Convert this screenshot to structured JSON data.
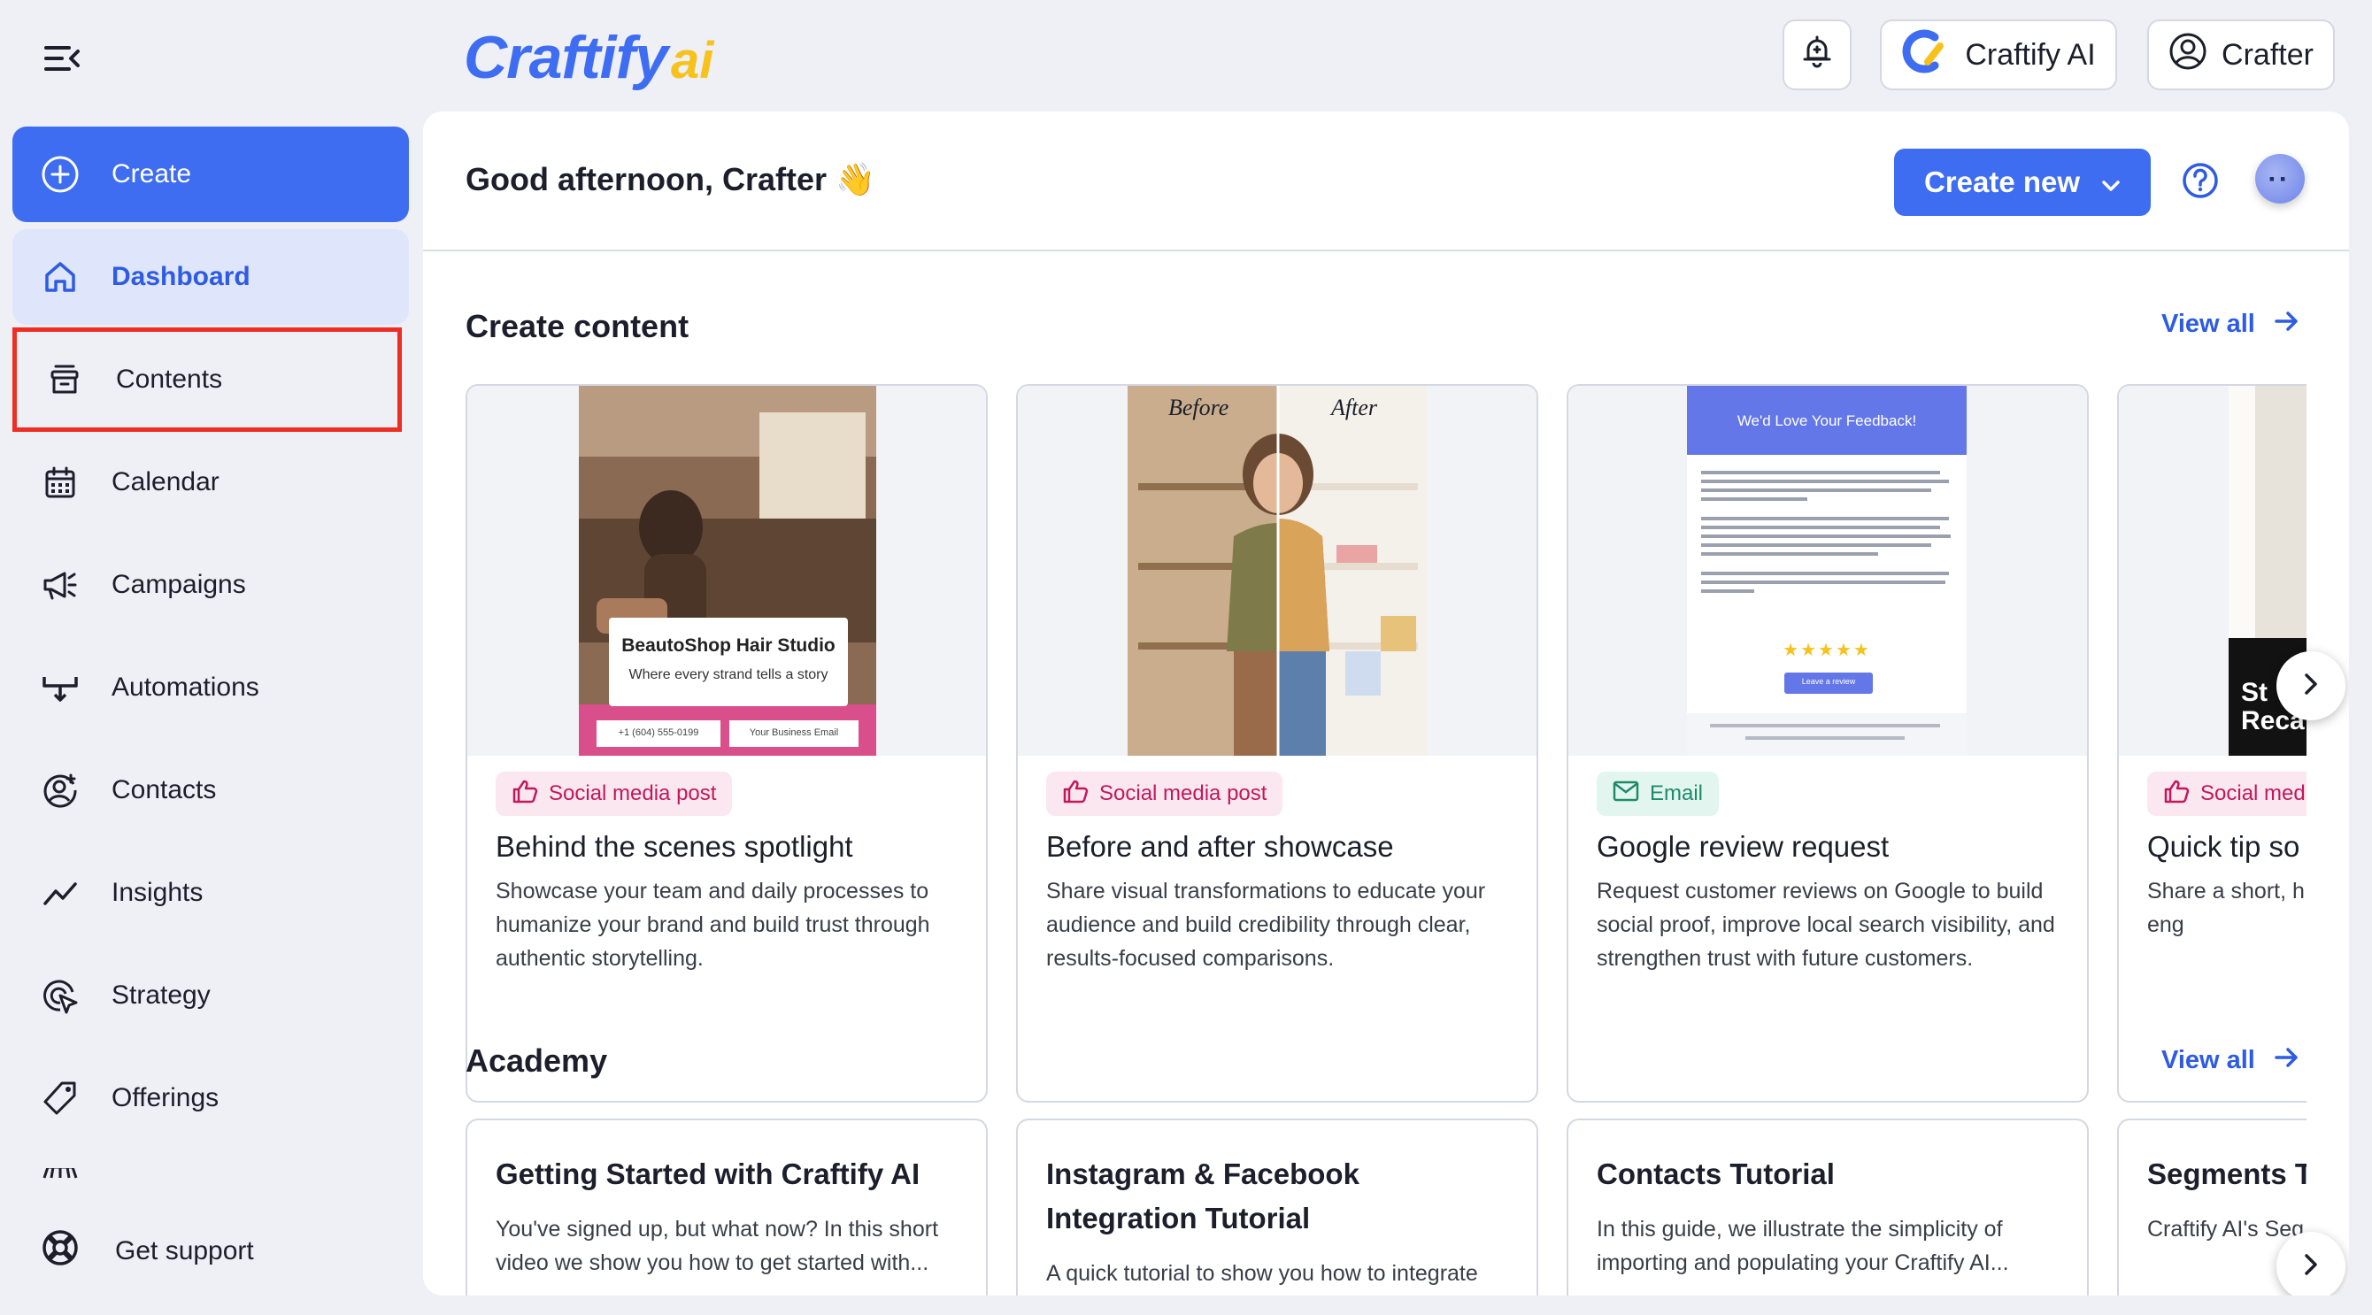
{
  "header": {
    "logo_main": "Craftify",
    "logo_ai": "ai",
    "craftify_ai_label": "Craftify AI",
    "user_label": "Crafter"
  },
  "sidebar": {
    "items": [
      {
        "label": "Create",
        "icon": "plus-circle-icon"
      },
      {
        "label": "Dashboard",
        "icon": "home-icon"
      },
      {
        "label": "Contents",
        "icon": "archive-icon"
      },
      {
        "label": "Calendar",
        "icon": "calendar-icon"
      },
      {
        "label": "Campaigns",
        "icon": "megaphone-icon"
      },
      {
        "label": "Automations",
        "icon": "automation-icon"
      },
      {
        "label": "Contacts",
        "icon": "contact-icon"
      },
      {
        "label": "Insights",
        "icon": "trend-icon"
      },
      {
        "label": "Strategy",
        "icon": "target-icon"
      },
      {
        "label": "Offerings",
        "icon": "tag-icon"
      }
    ],
    "support_label": "Get support"
  },
  "main": {
    "greeting": "Good afternoon, Crafter",
    "greeting_emoji": "👋",
    "create_new_label": "Create new",
    "create_content": {
      "title": "Create content",
      "view_all": "View all",
      "cards": [
        {
          "tag": "Social media post",
          "title": "Behind the scenes spotlight",
          "desc": "Showcase your team and daily processes to humanize your brand and build trust through authentic storytelling.",
          "image_brand": "BeautoShop Hair Studio",
          "image_tagline": "Where every strand tells a story",
          "image_phone": "+1 (604) 555-0199",
          "image_email": "Your Business Email"
        },
        {
          "tag": "Social media post",
          "title": "Before and after showcase",
          "desc": "Share visual transformations to educate your audience and build credibility through clear, results-focused comparisons.",
          "image_before": "Before",
          "image_after": "After"
        },
        {
          "tag": "Email",
          "title": "Google review request",
          "desc": "Request customer reviews on Google to build social proof, improve local search visibility, and strengthen trust with future customers.",
          "image_header": "We'd Love Your Feedback!",
          "image_stars": "★★★★★",
          "image_button": "Leave a review"
        },
        {
          "tag": "Social med",
          "title": "Quick tip so",
          "desc": "Share a short, h audiences fast a shares, and eng",
          "image_text_1": "St",
          "image_text_2": "Reca"
        }
      ]
    },
    "academy": {
      "title": "Academy",
      "view_all": "View all",
      "cards": [
        {
          "title": "Getting Started with Craftify AI",
          "desc": "You've signed up, but what now? In this short video we show you how to get started with..."
        },
        {
          "title": "Instagram & Facebook Integration Tutorial",
          "desc": "A quick tutorial to show you how to integrate"
        },
        {
          "title": "Contacts Tutorial",
          "desc": "In this guide, we illustrate the simplicity of importing and populating your Craftify AI..."
        },
        {
          "title": "Segments T",
          "desc": "Craftify AI's Seg organizes bu"
        }
      ]
    }
  },
  "colors": {
    "accent": "#3e6df2",
    "highlight_border": "#ee2d24",
    "social_tag": "#c2185b",
    "email_tag": "#1f8a68"
  }
}
